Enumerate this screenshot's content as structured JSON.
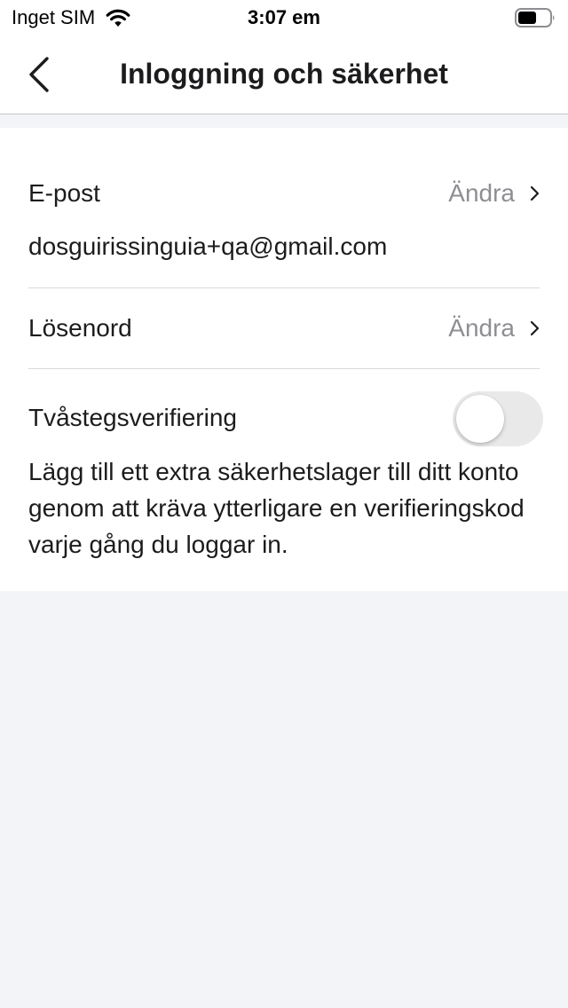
{
  "status_bar": {
    "carrier": "Inget SIM",
    "time": "3:07 em",
    "icons": [
      "wifi-icon",
      "battery-icon"
    ]
  },
  "nav": {
    "title": "Inloggning och säkerhet",
    "back_icon": "chevron-left-icon"
  },
  "settings": {
    "email": {
      "label": "E-post",
      "action": "Ändra",
      "value": "dosguirissinguia+qa@gmail.com"
    },
    "password": {
      "label": "Lösenord",
      "action": "Ändra"
    },
    "two_step": {
      "label": "Tvåstegsverifiering",
      "enabled": false,
      "description": "Lägg till ett extra säkerhetslager till ditt konto genom att kräva ytterligare en verifieringskod varje gång du loggar in."
    }
  },
  "colors": {
    "page_background": "#f3f4f8",
    "card_background": "#ffffff",
    "text_primary": "#1c1c1e",
    "text_secondary": "#8e8e93",
    "toggle_off": "#e9e9ea"
  }
}
